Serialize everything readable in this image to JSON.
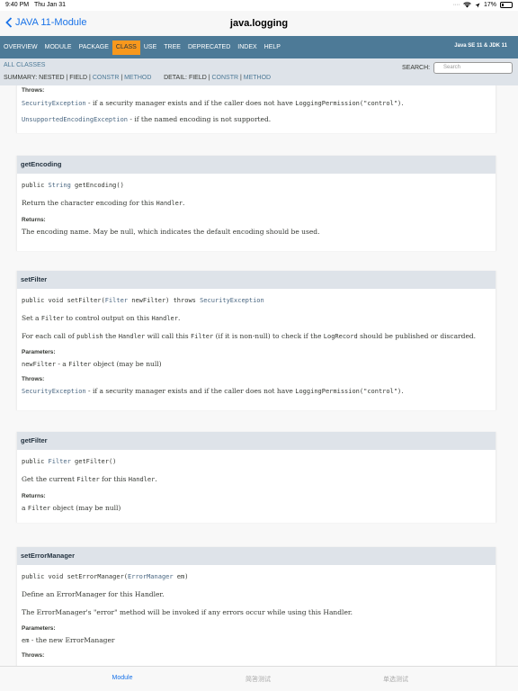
{
  "status": {
    "time": "9:40 PM",
    "date": "Thu Jan 31",
    "battery": "17%"
  },
  "nav": {
    "back": "JAVA 11-Module",
    "title": "java.logging"
  },
  "topnav": {
    "items": [
      "OVERVIEW",
      "MODULE",
      "PACKAGE",
      "CLASS",
      "USE",
      "TREE",
      "DEPRECATED",
      "INDEX",
      "HELP"
    ],
    "brand": "Java SE 11 & JDK 11"
  },
  "subnav": {
    "all_classes": "ALL CLASSES",
    "summary_prefix": "SUMMARY: NESTED | FIELD | ",
    "summary_constr": "CONSTR",
    "summary_sep": " | ",
    "summary_method": "METHOD",
    "detail_prefix": "DETAIL: FIELD | ",
    "detail_constr": "CONSTR",
    "detail_method": "METHOD",
    "search_label": "SEARCH:",
    "search_placeholder": "Search"
  },
  "panel0": {
    "throws_label": "Throws:",
    "ex1": "SecurityException",
    "ex1_text": " - if a security manager exists and if the caller does not have ",
    "perm": "LoggingPermission(\"control\")",
    "ex1_end": ".",
    "ex2": "UnsupportedEncodingException",
    "ex2_text": " - if the named encoding is not supported."
  },
  "getEncoding": {
    "title": "getEncoding",
    "sig_pre": "public ",
    "sig_type": "String",
    "sig_post": " getEncoding()",
    "desc_pre": "Return the character encoding for this ",
    "desc_code": "Handler",
    "desc_end": ".",
    "returns_label": "Returns:",
    "returns": "The encoding name. May be null, which indicates the default encoding should be used."
  },
  "setFilter": {
    "title": "setFilter",
    "sig_pre": "public void setFilter(",
    "sig_type": "Filter",
    "sig_mid": " newFilter) throws ",
    "sig_ex": "SecurityException",
    "desc1_pre": "Set a ",
    "desc1_code": "Filter",
    "desc1_mid": " to control output on this ",
    "desc1_code2": "Handler",
    "desc1_end": ".",
    "desc2_a": "For each call of ",
    "desc2_b": "publish",
    "desc2_c": " the ",
    "desc2_d": "Handler",
    "desc2_e": " will call this ",
    "desc2_f": "Filter",
    "desc2_g": " (if it is non-null) to check if the ",
    "desc2_h": "LogRecord",
    "desc2_i": " should be published or discarded.",
    "params_label": "Parameters:",
    "param_name": "newFilter",
    "param_a": " - a ",
    "param_code": "Filter",
    "param_b": " object (may be null)",
    "throws_label": "Throws:",
    "ex": "SecurityException",
    "ex_text": " - if a security manager exists and if the caller does not have ",
    "perm": "LoggingPermission(\"control\")",
    "ex_end": "."
  },
  "getFilter": {
    "title": "getFilter",
    "sig_pre": "public ",
    "sig_type": "Filter",
    "sig_post": " getFilter()",
    "desc_pre": "Get the current ",
    "desc_code": "Filter",
    "desc_mid": " for this ",
    "desc_code2": "Handler",
    "desc_end": ".",
    "returns_label": "Returns:",
    "ret_pre": "a ",
    "ret_code": "Filter",
    "ret_post": " object (may be null)"
  },
  "setErrorManager": {
    "title": "setErrorManager",
    "sig_pre": "public void setErrorManager(",
    "sig_type": "ErrorManager",
    "sig_post": " em)",
    "desc1": "Define an ErrorManager for this Handler.",
    "desc2": "The ErrorManager's \"error\" method will be invoked if any errors occur while using this Handler.",
    "params_label": "Parameters:",
    "param_name": "em",
    "param_text": " - the new ErrorManager",
    "throws_label": "Throws:"
  },
  "tabs": [
    "Module",
    "简答测试",
    "单选测试"
  ]
}
